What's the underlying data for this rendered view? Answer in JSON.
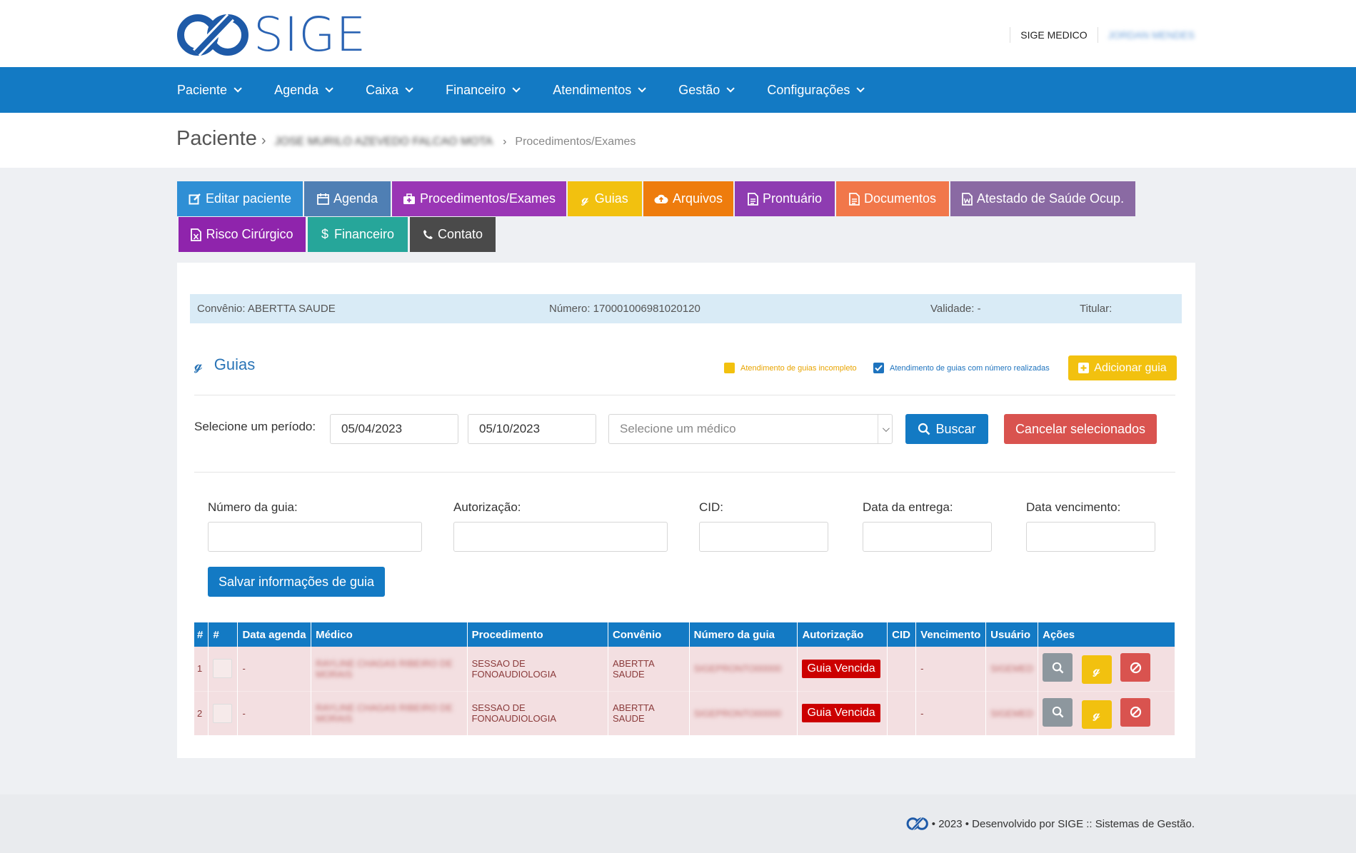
{
  "header": {
    "logo_text": "SIGE",
    "role": "SIGE MEDICO",
    "user_name": "JORDAN MENDES"
  },
  "nav": {
    "items": [
      "Paciente",
      "Agenda",
      "Caixa",
      "Financeiro",
      "Atendimentos",
      "Gestão",
      "Configurações"
    ]
  },
  "breadcrumb": {
    "title": "Paciente",
    "separator": "›",
    "patient": "JOSE MURILO AZEVEDO FALCAO MOTA",
    "current": "Procedimentos/Exames"
  },
  "tabs": [
    {
      "label": "Editar paciente",
      "icon": "edit-icon",
      "color": "#2f8fd5"
    },
    {
      "label": "Agenda",
      "icon": "calendar-icon",
      "color": "#4f7fb4"
    },
    {
      "label": "Procedimentos/Exames",
      "icon": "medkit-icon",
      "color": "#9a36b5"
    },
    {
      "label": "Guias",
      "icon": "guide-icon",
      "color": "#f2c10f"
    },
    {
      "label": "Arquivos",
      "icon": "cloud-upload-icon",
      "color": "#ee7c0d"
    },
    {
      "label": "Prontuário",
      "icon": "document-icon",
      "color": "#8e3cb1"
    },
    {
      "label": "Documentos",
      "icon": "document-icon",
      "color": "#f1774a"
    },
    {
      "label": "Atestado de Saúde Ocup.",
      "icon": "word-file-icon",
      "color": "#8a6aa3"
    },
    {
      "label": "Risco Cirúrgico",
      "icon": "excel-file-icon",
      "color": "#8f24ac"
    },
    {
      "label": "Financeiro",
      "icon": "dollar-icon",
      "color": "#26a69a"
    },
    {
      "label": "Contato",
      "icon": "phone-icon",
      "color": "#4a4a4a"
    }
  ],
  "insurance": {
    "convenio": "Convênio: ABERTTA SAUDE",
    "numero": "Número: 170001006981020120",
    "validade": "Validade: -",
    "titular": "Titular:"
  },
  "guias": {
    "title": "Guias",
    "legend_incomplete": "Atendimento de guias incompleto",
    "legend_done": "Atendimento de guias com número realizadas",
    "add_button": "Adicionar guia",
    "colors": {
      "incomplete": "#f2c10f",
      "done": "#1e73be",
      "add": "#f2c10f"
    }
  },
  "filter": {
    "label": "Selecione um período:",
    "date_from": "05/04/2023",
    "date_to": "05/10/2023",
    "doctor_placeholder": "Selecione um médico",
    "search_button": "Buscar",
    "cancel_button": "Cancelar selecionados"
  },
  "form": {
    "numero_label": "Número da guia:",
    "autorizacao_label": "Autorização:",
    "cid_label": "CID:",
    "entrega_label": "Data da entrega:",
    "vencimento_label": "Data vencimento:",
    "save_button": "Salvar informações de guia"
  },
  "table": {
    "headers": [
      "#",
      "#",
      "Data agenda",
      "Médico",
      "Procedimento",
      "Convênio",
      "Número da guia",
      "Autorização",
      "CID",
      "Vencimento",
      "Usuário",
      "Ações"
    ],
    "rows": [
      {
        "n": "1",
        "data": "-",
        "medico": "RAYLINE CHAGAS RIBEIRO DE MORAIS",
        "procedimento": "SESSAO DE FONOAUDIOLOGIA",
        "convenio": "ABERTTA SAUDE",
        "numero": "SIGEPRONTO00000",
        "autorizacao": "Guia Vencida",
        "cid": "",
        "vencimento": "-",
        "usuario": "SIGEMED"
      },
      {
        "n": "2",
        "data": "-",
        "medico": "RAYLINE CHAGAS RIBEIRO DE MORAIS",
        "procedimento": "SESSAO DE FONOAUDIOLOGIA",
        "convenio": "ABERTTA SAUDE",
        "numero": "SIGEPRONTO00000",
        "autorizacao": "Guia Vencida",
        "cid": "",
        "vencimento": "-",
        "usuario": "SIGEMED"
      }
    ]
  },
  "footer": {
    "text": "• 2023 • Desenvolvido por SIGE :: Sistemas de Gestão."
  }
}
